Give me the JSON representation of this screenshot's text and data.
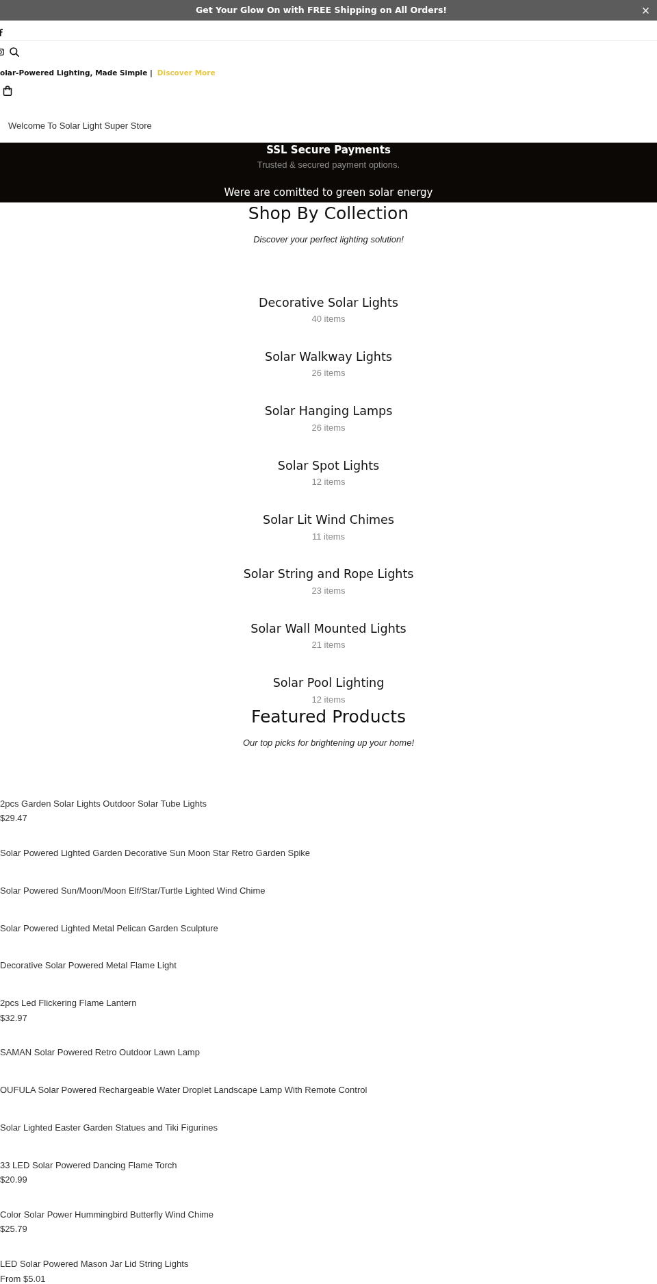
{
  "announcement_bar": {
    "text": "Get Your Glow On with FREE Shipping on All Orders!"
  },
  "header": {
    "tagline": "olar-Powered Lighting, Made Simple |",
    "tagline_link": "Discover More",
    "welcome": "Welcome To Solar Light Super Store"
  },
  "trust_banner": {
    "title": "SSL Secure Payments",
    "subtitle": "Trusted & secured payment options.",
    "message": "Were are comitted to green solar energy"
  },
  "collections": {
    "title": "Shop By Collection",
    "subtitle": "Discover your perfect lighting solution!",
    "items": [
      {
        "name": "Decorative Solar Lights",
        "count": "40 items"
      },
      {
        "name": "Solar Walkway Lights",
        "count": "26 items"
      },
      {
        "name": "Solar Hanging Lamps",
        "count": "26 items"
      },
      {
        "name": "Solar Spot Lights",
        "count": "12 items"
      },
      {
        "name": "Solar Lit Wind Chimes",
        "count": "11 items"
      },
      {
        "name": "Solar String and Rope Lights",
        "count": "23 items"
      },
      {
        "name": "Solar Wall Mounted Lights",
        "count": "21 items"
      },
      {
        "name": "Solar Pool Lighting",
        "count": "12 items"
      }
    ]
  },
  "featured_products": {
    "title": "Featured Products",
    "subtitle": "Our top picks for brightening up your home!",
    "items": [
      {
        "title": "2pcs Garden Solar Lights Outdoor Solar Tube Lights",
        "price": "$29.47"
      },
      {
        "title": "Solar Powered Lighted Garden Decorative Sun Moon Star Retro Garden Spike"
      },
      {
        "title": "Solar Powered Sun/Moon/Moon Elf/Star/Turtle Lighted Wind Chime"
      },
      {
        "title": "Solar Powered Lighted Metal Pelican Garden Sculpture"
      },
      {
        "title": "Decorative Solar Powered Metal Flame Light"
      },
      {
        "title": "2pcs Led Flickering Flame Lantern",
        "price": "$32.97"
      },
      {
        "title": "SAMAN Solar Powered Retro Outdoor Lawn Lamp"
      },
      {
        "title": "OUFULA Solar Powered Rechargeable Water Droplet Landscape Lamp With Remote Control"
      },
      {
        "title": "Solar Lighted Easter Garden Statues and Tiki Figurines"
      },
      {
        "title": "33 LED Solar Powered Dancing Flame Torch",
        "price": "$20.99"
      },
      {
        "title": "Color Solar Power Hummingbird Butterfly Wind Chime",
        "price": "$25.79"
      },
      {
        "title": "LED Solar Powered Mason Jar Lid String Lights",
        "price": "From $5.01"
      }
    ]
  }
}
